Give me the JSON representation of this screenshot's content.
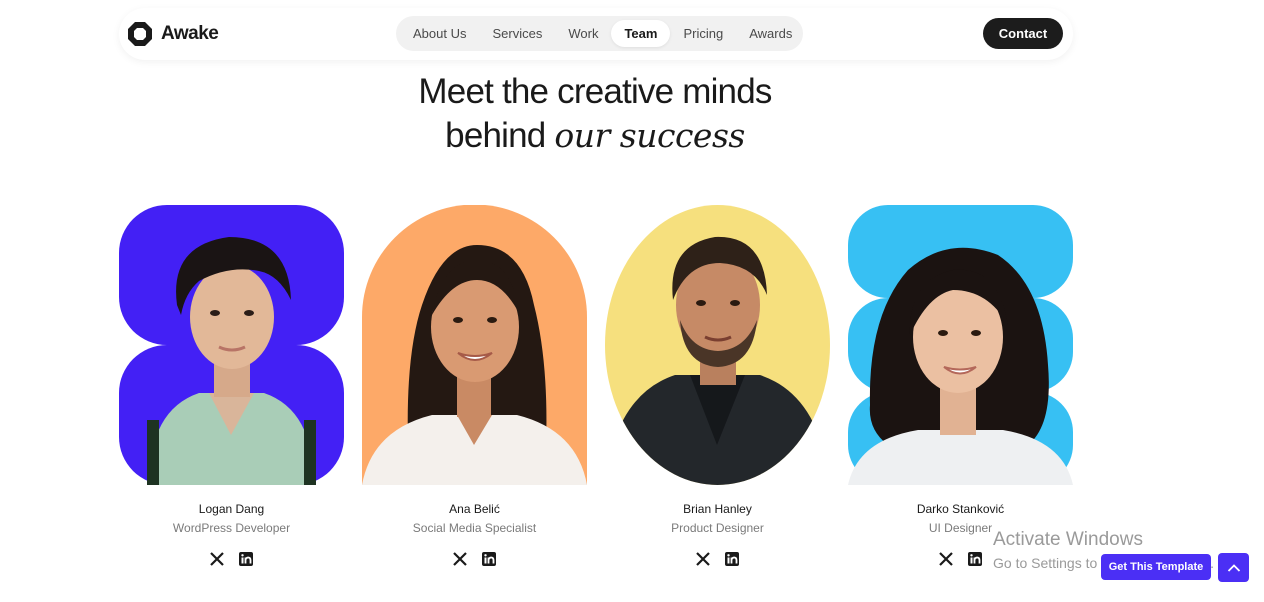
{
  "header": {
    "logo_text": "Awake",
    "nav": [
      {
        "label": "About Us",
        "active": false
      },
      {
        "label": "Services",
        "active": false
      },
      {
        "label": "Work",
        "active": false
      },
      {
        "label": "Team",
        "active": true
      },
      {
        "label": "Pricing",
        "active": false
      },
      {
        "label": "Awards",
        "active": false
      }
    ],
    "contact_label": "Contact"
  },
  "heading": {
    "line1": "Meet the creative minds",
    "line2_plain": "behind ",
    "line2_italic": "our success"
  },
  "team": [
    {
      "name": "Logan Dang",
      "role": "WordPress Developer",
      "bg_color": "#4320f5"
    },
    {
      "name": "Ana Belić",
      "role": "Social Media Specialist",
      "bg_color": "#fda968"
    },
    {
      "name": "Brian Hanley",
      "role": "Product Designer",
      "bg_color": "#f6e07e"
    },
    {
      "name": "Darko Stanković",
      "role": "UI Designer",
      "bg_color": "#37c0f3"
    }
  ],
  "social_icons": [
    "x-icon",
    "linkedin-icon"
  ],
  "watermark": {
    "line1": "Activate Windows",
    "line2": "Go to Settings to activate Windows."
  },
  "template_button": "Get This Template",
  "colors": {
    "accent": "#4b2ff5",
    "dark": "#1c1c1c",
    "nav_bg": "#f1f1f1"
  }
}
